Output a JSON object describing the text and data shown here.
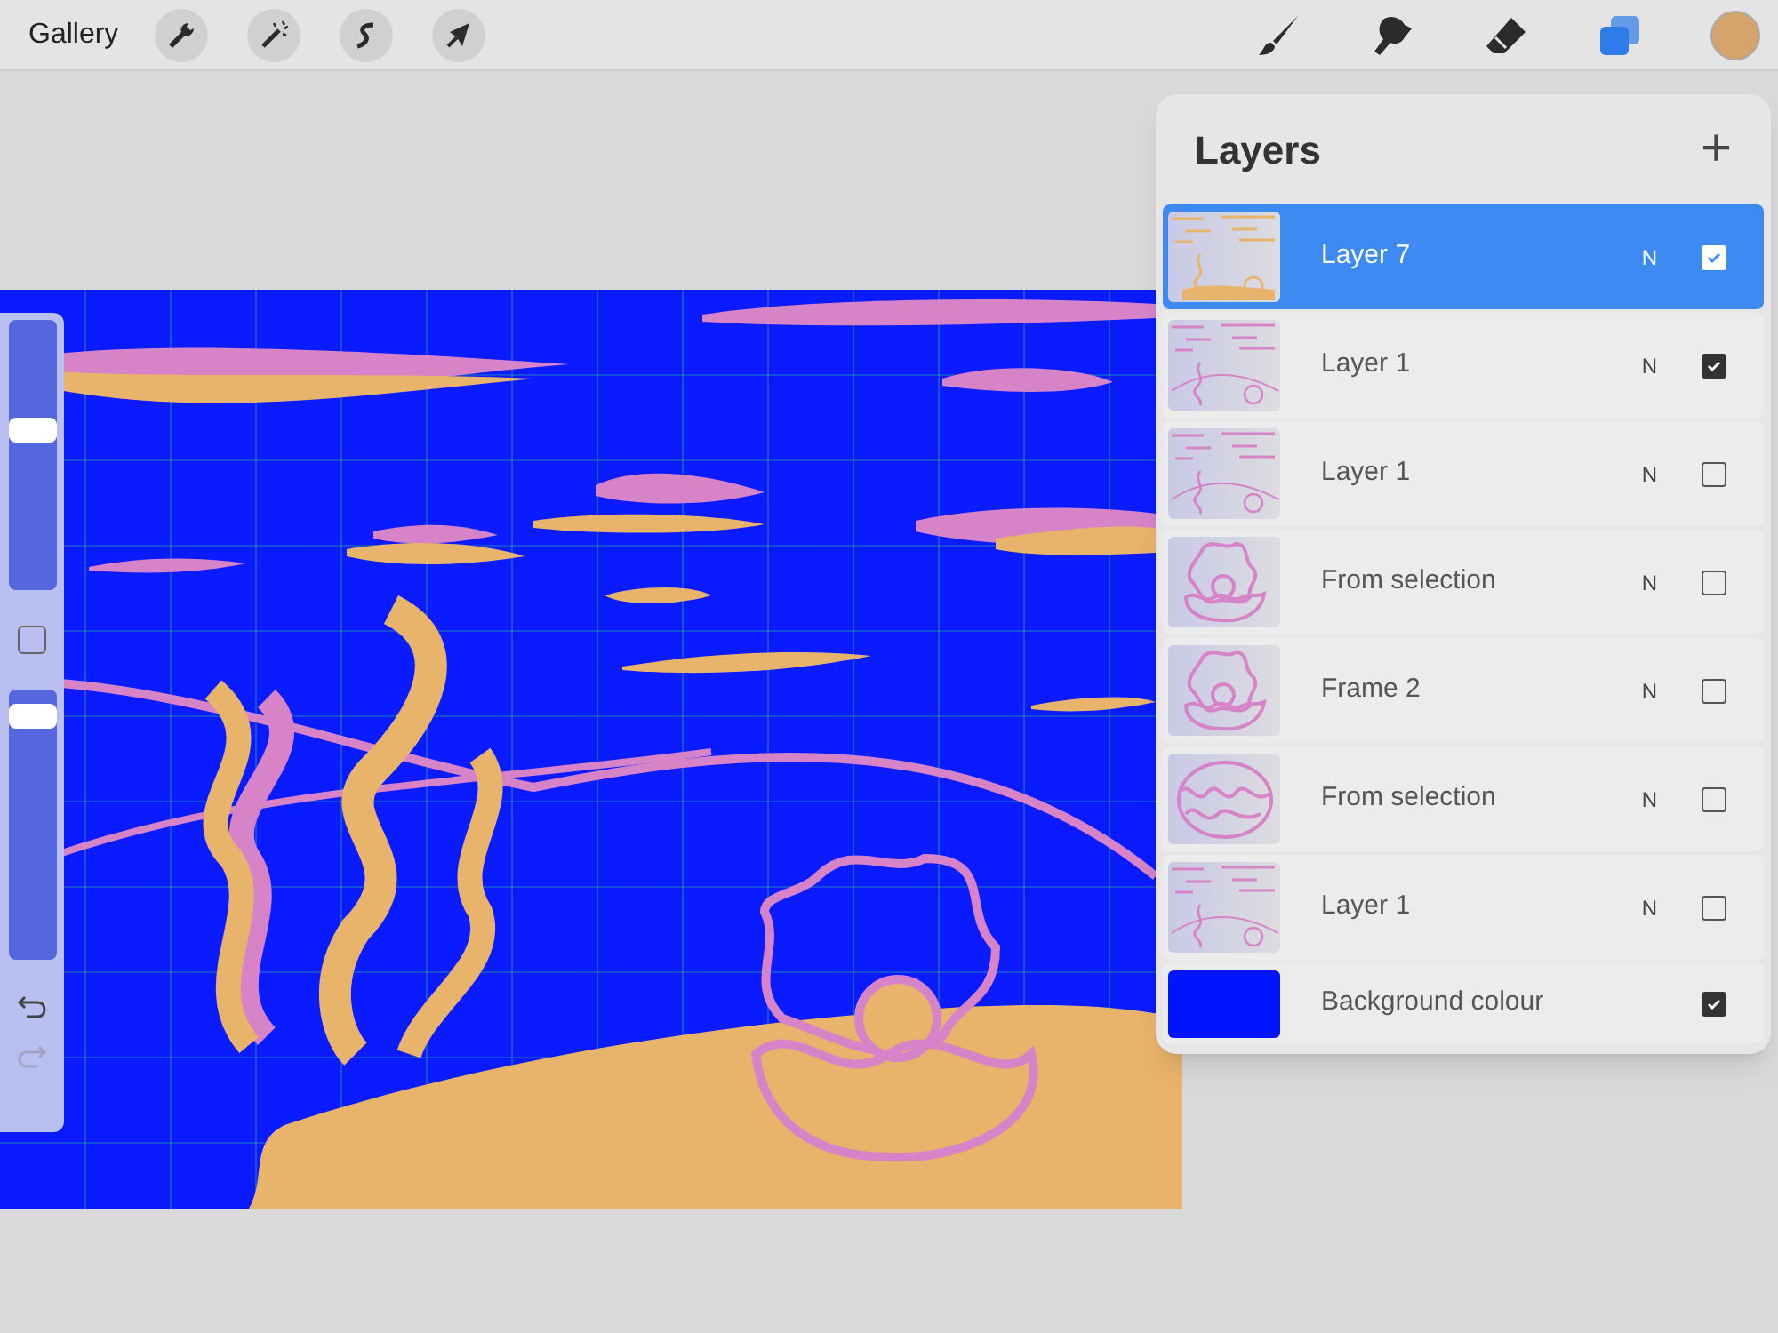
{
  "toolbar": {
    "gallery": "Gallery",
    "tools": [
      {
        "kind": "brush",
        "selected": false
      },
      {
        "kind": "smudge",
        "selected": false
      },
      {
        "kind": "eraser",
        "selected": false
      },
      {
        "kind": "layers",
        "selected": true
      }
    ]
  },
  "sidebar": {
    "sliders": [
      {
        "level": 0.6
      },
      {
        "level": 0.94
      }
    ],
    "undo_disabled": false,
    "redo_disabled": true
  },
  "layers_panel": {
    "title": "Layers",
    "add": "+",
    "layers": [
      {
        "name": "Layer 7",
        "kind": "layer",
        "thumbnail": {
          "kind": "scene_orange"
        },
        "blend": "N",
        "visible": true,
        "selected": true
      },
      {
        "name": "Layer 1",
        "kind": "layer",
        "thumbnail": {
          "kind": "scene_pink"
        },
        "blend": "N",
        "visible": true,
        "selected": false
      },
      {
        "name": "Layer 1",
        "kind": "layer",
        "thumbnail": {
          "kind": "scene_pink"
        },
        "blend": "N",
        "visible": false,
        "selected": false
      },
      {
        "name": "From selection",
        "kind": "layer",
        "thumbnail": {
          "kind": "shell_open"
        },
        "blend": "N",
        "visible": false,
        "selected": false
      },
      {
        "name": "Frame 2",
        "kind": "layer",
        "thumbnail": {
          "kind": "shell_open"
        },
        "blend": "N",
        "visible": false,
        "selected": false
      },
      {
        "name": "From selection",
        "kind": "layer",
        "thumbnail": {
          "kind": "shell_closed"
        },
        "blend": "N",
        "visible": false,
        "selected": false
      },
      {
        "name": "Layer 1",
        "kind": "layer",
        "thumbnail": {
          "kind": "scene_pink"
        },
        "blend": "N",
        "visible": false,
        "selected": false
      },
      {
        "name": "Background colour",
        "kind": "background",
        "visible": true,
        "selected": false
      }
    ]
  }
}
